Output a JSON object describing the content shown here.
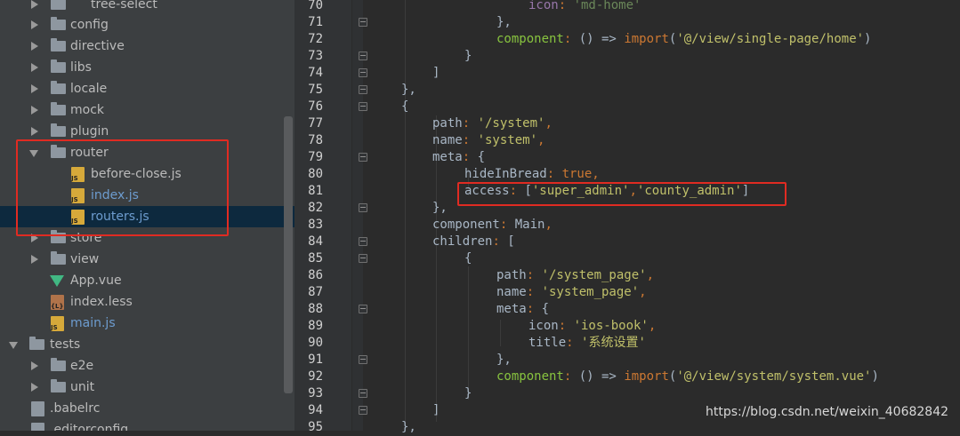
{
  "file_tree": {
    "items": [
      {
        "label": "tree-select",
        "type": "folder",
        "expanded": false
      },
      {
        "label": "config",
        "type": "folder",
        "expanded": false
      },
      {
        "label": "directive",
        "type": "folder",
        "expanded": false
      },
      {
        "label": "libs",
        "type": "folder",
        "expanded": false
      },
      {
        "label": "locale",
        "type": "folder",
        "expanded": false
      },
      {
        "label": "mock",
        "type": "folder",
        "expanded": false
      },
      {
        "label": "plugin",
        "type": "folder",
        "expanded": false
      },
      {
        "label": "router",
        "type": "folder",
        "expanded": true
      },
      {
        "label": "before-close.js",
        "type": "js-file"
      },
      {
        "label": "index.js",
        "type": "js-file"
      },
      {
        "label": "routers.js",
        "type": "js-file",
        "selected": true
      },
      {
        "label": "store",
        "type": "folder",
        "expanded": false
      },
      {
        "label": "view",
        "type": "folder",
        "expanded": false
      },
      {
        "label": "App.vue",
        "type": "vue-file"
      },
      {
        "label": "index.less",
        "type": "less-file"
      },
      {
        "label": "main.js",
        "type": "js-file"
      },
      {
        "label": "tests",
        "type": "folder",
        "expanded": true
      },
      {
        "label": "e2e",
        "type": "folder",
        "expanded": false
      },
      {
        "label": "unit",
        "type": "folder",
        "expanded": false
      },
      {
        "label": ".babelrc",
        "type": "config-file"
      },
      {
        "label": ".editorconfig",
        "type": "config-file"
      }
    ]
  },
  "editor": {
    "line_numbers": [
      "70",
      "71",
      "72",
      "73",
      "74",
      "75",
      "76",
      "77",
      "78",
      "79",
      "80",
      "81",
      "82",
      "83",
      "84",
      "85",
      "86",
      "87",
      "88",
      "89",
      "90",
      "91",
      "92",
      "93",
      "94",
      "95"
    ]
  },
  "code": {
    "l70_key": "icon",
    "l70_val": "'md-home'",
    "l71": "},",
    "l72_key": "component",
    "l72_arrow": "() =>",
    "l72_import": "import",
    "l72_arg": "'@/view/single-page/home'",
    "l73": "}",
    "l74": "]",
    "l75": "},",
    "l76": "{",
    "l77_key": "path",
    "l77_val": "'/system'",
    "l78_key": "name",
    "l78_val": "'system'",
    "l79_key": "meta",
    "l79_rest": "{",
    "l80_key": "hideInBread",
    "l80_val": "true",
    "l81_key": "access",
    "l81_v1": "'super_admin'",
    "l81_v2": "'county_admin'",
    "l82": "},",
    "l83_key": "component",
    "l83_val": "Main",
    "l84_key": "children",
    "l84_rest": "[",
    "l85": "{",
    "l86_key": "path",
    "l86_val": "'/system_page'",
    "l87_key": "name",
    "l87_val": "'system_page'",
    "l88_key": "meta",
    "l88_rest": "{",
    "l89_key": "icon",
    "l89_val": "'ios-book'",
    "l90_key": "title",
    "l90_val": "'系统设置'",
    "l91": "},",
    "l92_key": "component",
    "l92_arrow": "() =>",
    "l92_import": "import",
    "l92_arg": "'@/view/system/system.vue'",
    "l93": "}",
    "l94": "]",
    "l95": "},"
  },
  "watermark": "https://blog.csdn.net/weixin_40682842",
  "colors": {
    "sidebar_bg": "#3c3f41",
    "editor_bg": "#2b2b2b",
    "keyword": "#cc7832",
    "string": "#6a8759",
    "highlight_box": "#e02b22"
  }
}
